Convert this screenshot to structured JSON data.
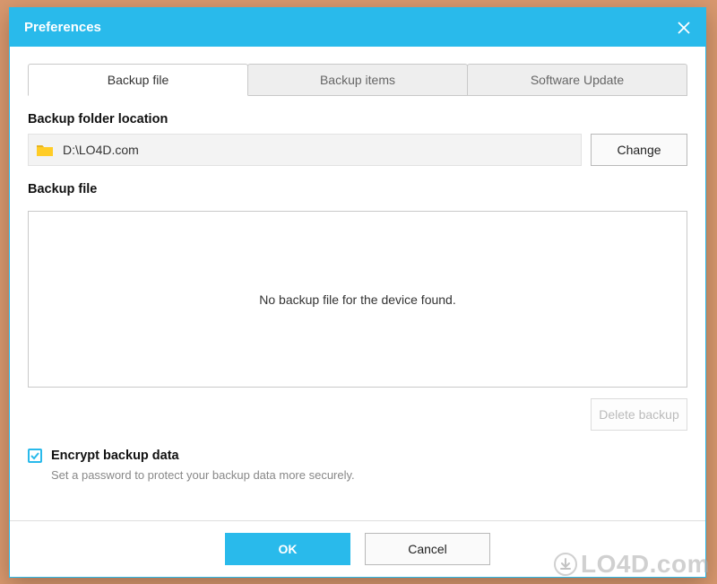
{
  "window": {
    "title": "Preferences"
  },
  "tabs": {
    "backup_file": "Backup file",
    "backup_items": "Backup items",
    "software_update": "Software Update"
  },
  "folder": {
    "section_label": "Backup folder location",
    "path": "D:\\LO4D.com",
    "change_button": "Change"
  },
  "file": {
    "section_label": "Backup file",
    "empty_message": "No backup file for the device found.",
    "delete_button": "Delete backup"
  },
  "encrypt": {
    "checked": true,
    "label": "Encrypt backup data",
    "hint": "Set a password to protect your backup data more securely."
  },
  "footer": {
    "ok": "OK",
    "cancel": "Cancel"
  },
  "watermark": "LO4D.com"
}
